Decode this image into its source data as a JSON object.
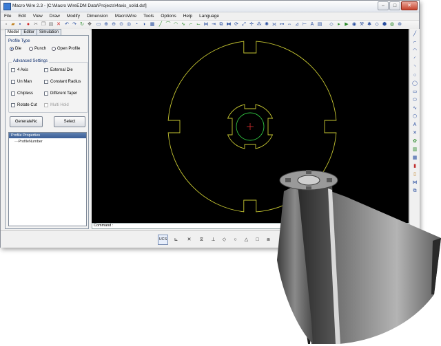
{
  "window": {
    "title": "Macro Wire 2.3 - [C:\\Macro WireEDM Data\\Projects\\4axis_solid.dxf]",
    "controls": {
      "minimize": "–",
      "maximize": "□",
      "close": "✕"
    }
  },
  "menu": [
    "File",
    "Edit",
    "View",
    "Draw",
    "Modify",
    "Dimension",
    "MacroWire",
    "Tools",
    "Options",
    "Help",
    "Language"
  ],
  "tabs": [
    {
      "label": "Model",
      "active": true
    },
    {
      "label": "Editor",
      "active": false
    },
    {
      "label": "Simulation",
      "active": false
    }
  ],
  "profile_type": {
    "title": "Profile Type",
    "options": [
      {
        "label": "Die",
        "selected": true
      },
      {
        "label": "Punch",
        "selected": false
      },
      {
        "label": "Open Profile",
        "selected": false
      }
    ]
  },
  "advanced": {
    "title": "Advanced Settings",
    "checks": [
      {
        "label": "4 Axis",
        "enabled": true
      },
      {
        "label": "External Die",
        "enabled": true
      },
      {
        "label": "Un Man",
        "enabled": true
      },
      {
        "label": "Constant Radius",
        "enabled": true
      },
      {
        "label": "Chipless",
        "enabled": true
      },
      {
        "label": "Different Taper",
        "enabled": true
      },
      {
        "label": "Rotate Cut",
        "enabled": true
      },
      {
        "label": "Multi Hold",
        "enabled": false
      }
    ]
  },
  "buttons": {
    "generate": "GenerateNc",
    "select": "Select"
  },
  "properties": {
    "title": "Profile Properties",
    "item": "ProfileNumber"
  },
  "command": {
    "label": "Command :"
  },
  "snap": {
    "ucs": "UCS"
  },
  "colors": {
    "canvas_bg": "#000000",
    "profile_line": "#c8c832",
    "circle": "#2fbf3f",
    "marker": "#e03030"
  }
}
